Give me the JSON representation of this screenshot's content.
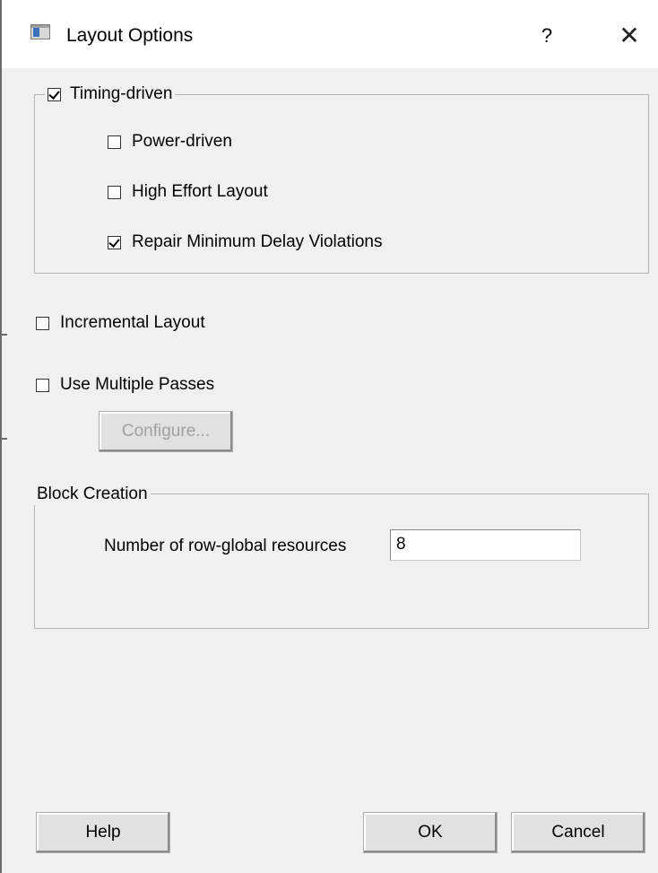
{
  "window": {
    "title": "Layout Options",
    "help_label": "?",
    "close_label": "✕",
    "icon": "window-app-icon"
  },
  "timing_group": {
    "label": "Timing-driven",
    "checked": true,
    "options": [
      {
        "label": "Power-driven",
        "checked": false
      },
      {
        "label": "High Effort Layout",
        "checked": false
      },
      {
        "label": "Repair Minimum Delay Violations",
        "checked": true
      }
    ]
  },
  "incremental_layout": {
    "label": "Incremental Layout",
    "checked": false
  },
  "multiple_passes": {
    "label": "Use Multiple Passes",
    "checked": false
  },
  "configure_button": {
    "label": "Configure...",
    "enabled": false
  },
  "block_creation": {
    "title": "Block Creation",
    "row_global_label": "Number of row-global resources",
    "row_global_value": "8"
  },
  "footer": {
    "help_label": "Help",
    "ok_label": "OK",
    "cancel_label": "Cancel"
  }
}
